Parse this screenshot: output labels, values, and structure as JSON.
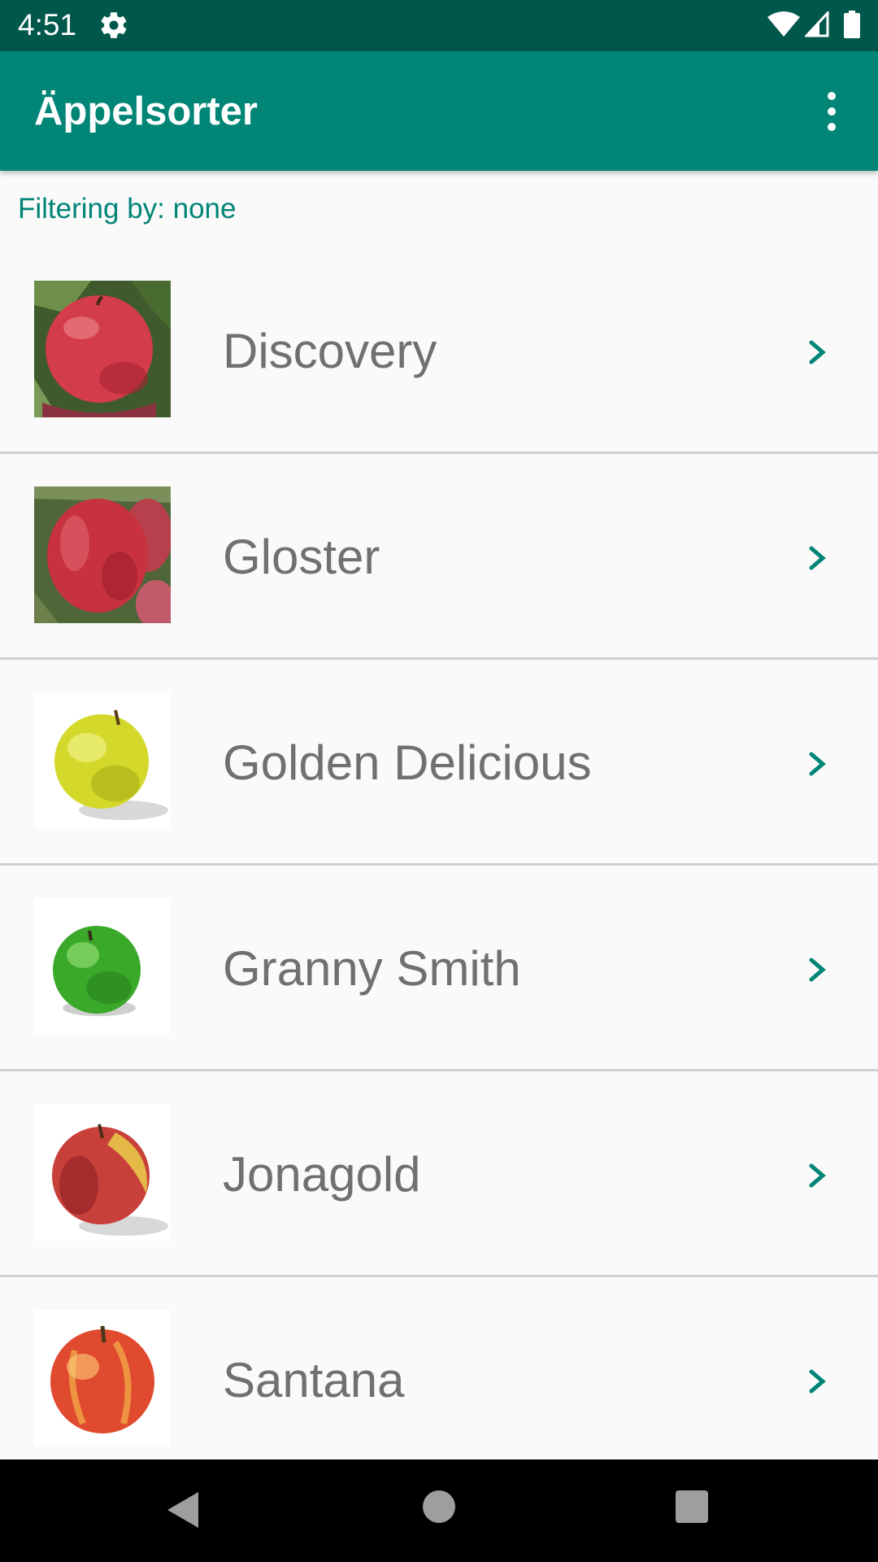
{
  "status_bar": {
    "time": "4:51",
    "icons": [
      "gear-icon",
      "wifi-icon",
      "cellular-signal-icon",
      "battery-icon"
    ]
  },
  "app_bar": {
    "title": "Äppelsorter",
    "menu_icon": "more-vertical-icon",
    "color": "#008577"
  },
  "filter": {
    "label": "Filtering by: none"
  },
  "apples": [
    {
      "name": "Discovery",
      "image": "red-apple-on-tree"
    },
    {
      "name": "Gloster",
      "image": "deep-red-apples-on-branch"
    },
    {
      "name": "Golden Delicious",
      "image": "yellow-green-apple"
    },
    {
      "name": "Granny Smith",
      "image": "green-apple"
    },
    {
      "name": "Jonagold",
      "image": "red-yellow-apple"
    },
    {
      "name": "Santana",
      "image": "red-yellow-striped-apple"
    }
  ],
  "list_item_icon": "chevron-right-icon",
  "colors": {
    "status_bar": "#00574b",
    "accent": "#008577",
    "item_text": "#707070"
  },
  "nav_bar": {
    "icons": [
      "back-icon",
      "home-icon",
      "recents-icon"
    ]
  }
}
